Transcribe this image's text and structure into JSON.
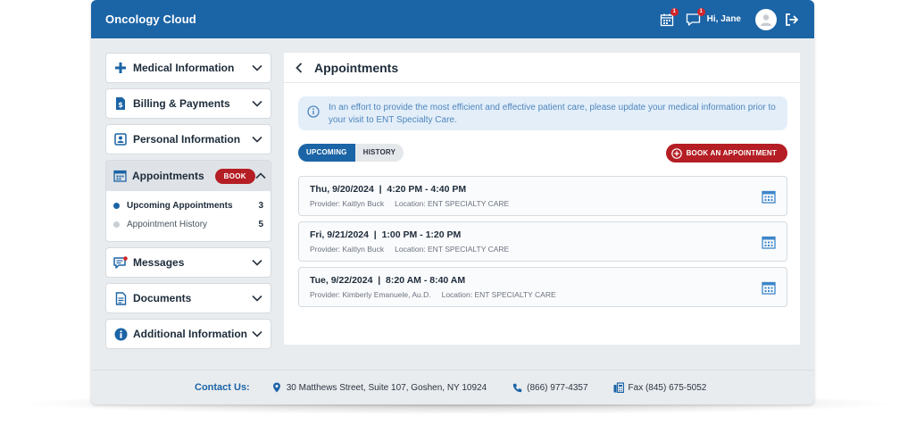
{
  "app": {
    "title": "Oncology Cloud",
    "greeting": "Hi, Jane",
    "calendar_badge": "1",
    "messages_badge": "1"
  },
  "sidebar": {
    "medical": "Medical Information",
    "billing": "Billing & Payments",
    "personal": "Personal Information",
    "appointments": "Appointments",
    "book": "BOOK",
    "upcoming": "Upcoming Appointments",
    "upcoming_count": "3",
    "history": "Appointment History",
    "history_count": "5",
    "messages": "Messages",
    "documents": "Documents",
    "additional": "Additional Information"
  },
  "main": {
    "title": "Appointments",
    "info": "In an effort to provide the most efficient and effective patient care, please update your medical information prior to your visit to ENT Specialty Care.",
    "tab_upcoming": "UPCOMING",
    "tab_history": "HISTORY",
    "book_button": "BOOK AN APPOINTMENT",
    "appointments": [
      {
        "date": "Thu, 9/20/2024  |  4:20 PM - 4:40 PM",
        "provider": "Provider: Kaitlyn Buck",
        "location": "Location: ENT SPECIALTY CARE"
      },
      {
        "date": "Fri, 9/21/2024  |  1:00 PM - 1:20 PM",
        "provider": "Provider: Kaitlyn Buck",
        "location": "Location: ENT SPECIALTY CARE"
      },
      {
        "date": "Tue, 9/22/2024  |  8:20 AM - 8:40 AM",
        "provider": "Provider: Kimberly Emanuele, Au.D.",
        "location": "Location: ENT SPECIALTY CARE"
      }
    ]
  },
  "footer": {
    "contact": "Contact Us:",
    "address": "30 Matthews Street, Suite 107, Goshen, NY 10924",
    "phone": "(866) 977-4357",
    "fax": "Fax (845) 675-5052"
  },
  "colors": {
    "primary": "#1b64a6",
    "accent_red": "#b41e24",
    "info_bg": "#e3eef9",
    "info_text": "#4f86bd"
  }
}
